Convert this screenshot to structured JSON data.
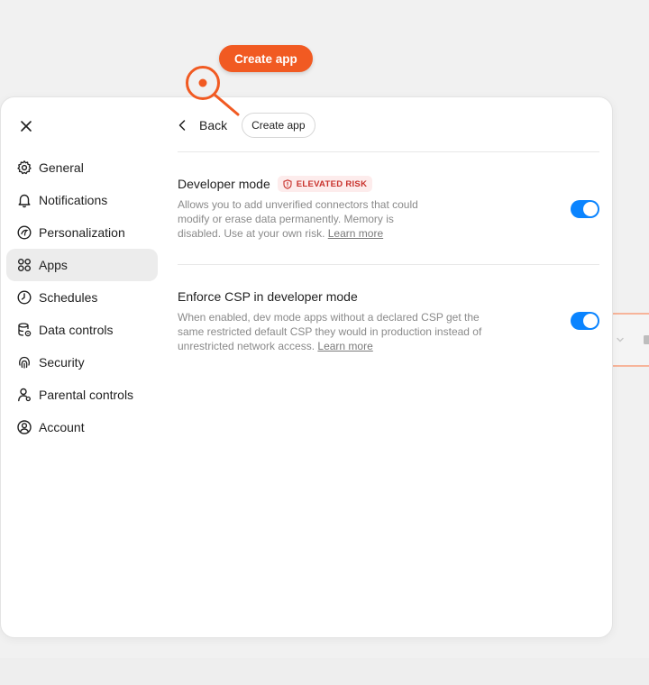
{
  "callout": {
    "label": "Create app"
  },
  "sidebar": {
    "items": [
      {
        "label": "General",
        "icon": "gear-icon",
        "active": false
      },
      {
        "label": "Notifications",
        "icon": "bell-icon",
        "active": false
      },
      {
        "label": "Personalization",
        "icon": "personalization-icon",
        "active": false
      },
      {
        "label": "Apps",
        "icon": "apps-grid-icon",
        "active": true
      },
      {
        "label": "Schedules",
        "icon": "clock-icon",
        "active": false
      },
      {
        "label": "Data controls",
        "icon": "database-icon",
        "active": false
      },
      {
        "label": "Security",
        "icon": "fingerprint-icon",
        "active": false
      },
      {
        "label": "Parental controls",
        "icon": "parental-icon",
        "active": false
      },
      {
        "label": "Account",
        "icon": "account-icon",
        "active": false
      }
    ]
  },
  "header": {
    "back_label": "Back",
    "create_label": "Create app"
  },
  "settings": [
    {
      "title": "Developer mode",
      "badge": "ELEVATED RISK",
      "description": "Allows you to add unverified connectors that could modify or erase data permanently. Memory is disabled. Use at your own risk.",
      "link": "Learn more",
      "enabled": true
    },
    {
      "title": "Enforce CSP in developer mode",
      "description": "When enabled, dev mode apps without a declared CSP get the same restricted default CSP they would in production instead of unrestricted network access.",
      "link": "Learn more",
      "enabled": true
    }
  ],
  "colors": {
    "accent": "#f15a22",
    "toggle_on": "#0a84ff",
    "risk_text": "#c8312b",
    "risk_bg": "#fdecec"
  }
}
